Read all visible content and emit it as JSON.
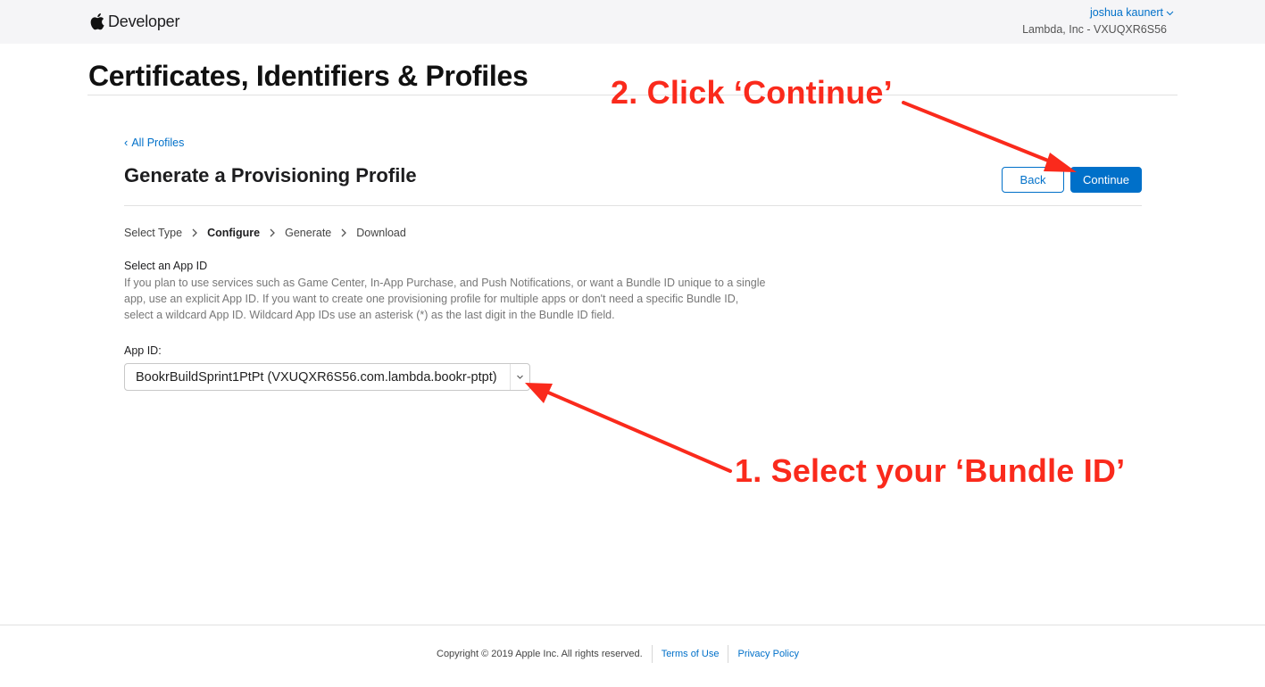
{
  "header": {
    "brand": "Developer",
    "user_name": "joshua kaunert",
    "team": "Lambda, Inc - VXUQXR6S56"
  },
  "page_title": "Certificates, Identifiers & Profiles",
  "content": {
    "back_link": "All Profiles",
    "section_title": "Generate a Provisioning Profile",
    "back_button": "Back",
    "continue_button": "Continue",
    "steps": [
      {
        "label": "Select Type",
        "active": false
      },
      {
        "label": "Configure",
        "active": true
      },
      {
        "label": "Generate",
        "active": false
      },
      {
        "label": "Download",
        "active": false
      }
    ],
    "select_label": "Select an App ID",
    "description": "If you plan to use services such as Game Center, In-App Purchase, and Push Notifications, or want a Bundle ID unique to a single app, use an explicit App ID. If you want to create one provisioning profile for multiple apps or don't need a specific Bundle ID, select a wildcard App ID. Wildcard App IDs use an asterisk (*) as the last digit in the Bundle ID field.",
    "app_id_label": "App ID:",
    "app_id_value": "BookrBuildSprint1PtPt (VXUQXR6S56.com.lambda.bookr-ptpt)"
  },
  "annotations": {
    "step1": "1. Select your ‘Bundle ID’",
    "step2": "2. Click ‘Continue’",
    "color": "#fa2a1c"
  },
  "footer": {
    "copyright": "Copyright © 2019 Apple Inc. All rights reserved.",
    "terms": "Terms of Use",
    "privacy": "Privacy Policy"
  },
  "colors": {
    "accent": "#0070c9",
    "topbar_bg": "#f5f5f7"
  }
}
